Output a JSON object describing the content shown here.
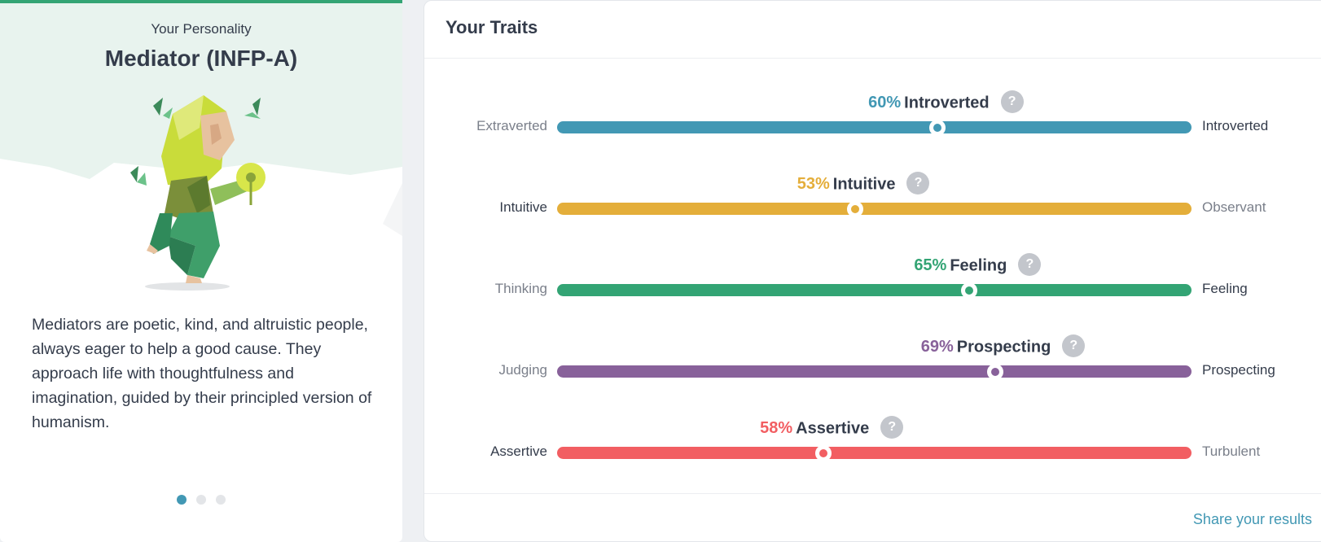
{
  "personality": {
    "eyebrow": "Your Personality",
    "title": "Mediator (INFP-A)",
    "description": "Mediators are poetic, kind, and altruistic people, always eager to help a good cause. They approach life with thoughtfulness and imagination, guided by their principled version of humanism.",
    "carousel_total": 3,
    "carousel_active": 1
  },
  "traits": {
    "title": "Your Traits",
    "share_label": "Share your results",
    "items": [
      {
        "percent_label": "60%",
        "name": "Introverted",
        "left": "Extraverted",
        "right": "Introverted",
        "strong_side": "right",
        "percent": 60,
        "color": "#4298b4",
        "help": "?"
      },
      {
        "percent_label": "53%",
        "name": "Intuitive",
        "left": "Intuitive",
        "right": "Observant",
        "strong_side": "left",
        "percent": 53,
        "color": "#e4ae3a",
        "help": "?"
      },
      {
        "percent_label": "65%",
        "name": "Feeling",
        "left": "Thinking",
        "right": "Feeling",
        "strong_side": "right",
        "percent": 65,
        "color": "#33a474",
        "help": "?"
      },
      {
        "percent_label": "69%",
        "name": "Prospecting",
        "left": "Judging",
        "right": "Prospecting",
        "strong_side": "right",
        "percent": 69,
        "color": "#88619a",
        "help": "?"
      },
      {
        "percent_label": "58%",
        "name": "Assertive",
        "left": "Assertive",
        "right": "Turbulent",
        "strong_side": "left",
        "percent": 58,
        "color": "#f25e62",
        "help": "?"
      }
    ]
  }
}
